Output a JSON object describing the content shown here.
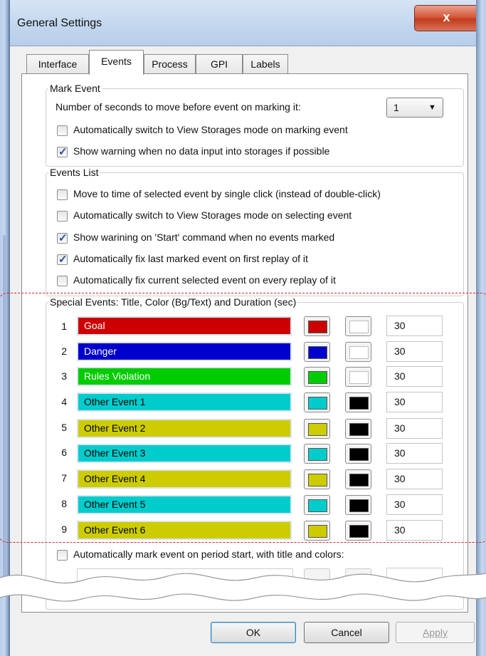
{
  "window": {
    "title": "General Settings",
    "close_glyph": "x"
  },
  "tabs": [
    "Interface",
    "Events",
    "Process",
    "GPI",
    "Labels"
  ],
  "active_tab": "Events",
  "mark_event": {
    "legend": "Mark Event",
    "seconds_label": "Number of seconds to move before event on marking it:",
    "seconds_value": "1",
    "options": [
      {
        "label": "Automatically switch to View Storages mode on marking event",
        "checked": false
      },
      {
        "label": "Show warning when no data input into storages if possible",
        "checked": true
      }
    ]
  },
  "events_list": {
    "legend": "Events List",
    "options": [
      {
        "label": "Move to time of selected event by single click (instead of double-click)",
        "checked": false
      },
      {
        "label": "Automatically switch to View Storages mode on selecting event",
        "checked": false
      },
      {
        "label": "Show warining on 'Start' command when no events marked",
        "checked": true
      },
      {
        "label": "Automatically fix last marked event on first replay of it",
        "checked": true
      },
      {
        "label": "Automatically fix current selected event on every replay of it",
        "checked": false
      }
    ]
  },
  "special_events": {
    "legend": "Special Events: Title, Color (Bg/Text) and Duration (sec)",
    "rows": [
      {
        "num": "1",
        "title": "Goal",
        "bg": "#cc0000",
        "text_color": "#ffffff",
        "duration": "30"
      },
      {
        "num": "2",
        "title": "Danger",
        "bg": "#0000cc",
        "text_color": "#ffffff",
        "duration": "30"
      },
      {
        "num": "3",
        "title": "Rules Violation",
        "bg": "#00cc00",
        "text_color": "#ffffff",
        "duration": "30"
      },
      {
        "num": "4",
        "title": "Other Event 1",
        "bg": "#00cccc",
        "text_color": "#000000",
        "duration": "30"
      },
      {
        "num": "5",
        "title": "Other Event 2",
        "bg": "#cccc00",
        "text_color": "#000000",
        "duration": "30"
      },
      {
        "num": "6",
        "title": "Other Event 3",
        "bg": "#00cccc",
        "text_color": "#000000",
        "duration": "30"
      },
      {
        "num": "7",
        "title": "Other Event 4",
        "bg": "#cccc00",
        "text_color": "#000000",
        "duration": "30"
      },
      {
        "num": "8",
        "title": "Other Event 5",
        "bg": "#00cccc",
        "text_color": "#000000",
        "duration": "30"
      },
      {
        "num": "9",
        "title": "Other Event 6",
        "bg": "#cccc00",
        "text_color": "#000000",
        "duration": "30"
      }
    ]
  },
  "auto_mark": {
    "label": "Automatically mark event on period start, with title and colors:",
    "checked": false
  },
  "buttons": {
    "ok": "OK",
    "cancel": "Cancel",
    "apply": "Apply"
  }
}
